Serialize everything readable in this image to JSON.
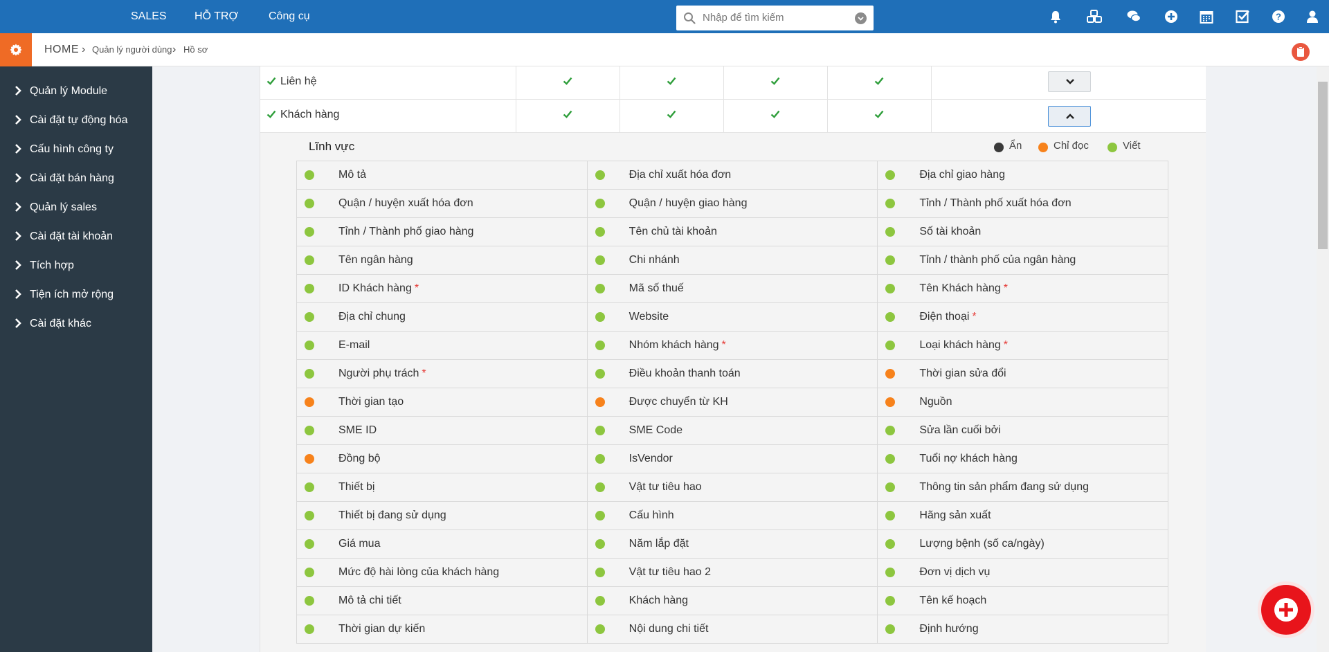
{
  "topnav": {
    "sales": "SALES",
    "support": "HỖ TRỢ",
    "tools": "Công cụ"
  },
  "search": {
    "placeholder": "Nhập để tìm kiếm"
  },
  "topicons": [
    "bell-icon",
    "cubes-icon",
    "chat-icon",
    "plus-circle-icon",
    "calendar-icon",
    "checkbox-icon",
    "help-icon",
    "user-icon"
  ],
  "breadcrumb": {
    "home": "HOME",
    "level1": "Quản lý người dùng",
    "level2": "Hồ sơ"
  },
  "sidebar": {
    "items": [
      {
        "label": "Quản lý Module"
      },
      {
        "label": "Cài đặt tự động hóa"
      },
      {
        "label": "Cấu hình công ty"
      },
      {
        "label": "Cài đặt bán hàng"
      },
      {
        "label": "Quản lý sales"
      },
      {
        "label": "Cài đặt tài khoản"
      },
      {
        "label": "Tích hợp"
      },
      {
        "label": "Tiện ích mở rộng"
      },
      {
        "label": "Cài đặt khác"
      }
    ]
  },
  "modules": [
    {
      "name": "Liên hệ",
      "expanded": false
    },
    {
      "name": "Khách hàng",
      "expanded": true
    }
  ],
  "fields_section": {
    "title": "Lĩnh vực",
    "legend": {
      "hidden": "Ẩn",
      "readonly": "Chỉ đọc",
      "write": "Viết"
    },
    "colors": {
      "hidden": "#3a3a3a",
      "readonly": "#f7821b",
      "write": "#8dc63f"
    },
    "rows": [
      [
        {
          "label": "Mô tả",
          "state": "write"
        },
        {
          "label": "Địa chỉ xuất hóa đơn",
          "state": "write"
        },
        {
          "label": "Địa chỉ giao hàng",
          "state": "write"
        }
      ],
      [
        {
          "label": "Quận / huyện xuất hóa đơn",
          "state": "write"
        },
        {
          "label": "Quận / huyện giao hàng",
          "state": "write"
        },
        {
          "label": "Tỉnh / Thành phố xuất hóa đơn",
          "state": "write"
        }
      ],
      [
        {
          "label": "Tỉnh / Thành phố giao hàng",
          "state": "write"
        },
        {
          "label": "Tên chủ tài khoản",
          "state": "write"
        },
        {
          "label": "Số tài khoản",
          "state": "write"
        }
      ],
      [
        {
          "label": "Tên ngân hàng",
          "state": "write"
        },
        {
          "label": "Chi nhánh",
          "state": "write"
        },
        {
          "label": "Tỉnh / thành phố của ngân hàng",
          "state": "write"
        }
      ],
      [
        {
          "label": "ID Khách hàng",
          "state": "write",
          "required": true
        },
        {
          "label": "Mã số thuế",
          "state": "write"
        },
        {
          "label": "Tên Khách hàng",
          "state": "write",
          "required": true
        }
      ],
      [
        {
          "label": "Địa chỉ chung",
          "state": "write"
        },
        {
          "label": "Website",
          "state": "write"
        },
        {
          "label": "Điện thoại",
          "state": "write",
          "required": true
        }
      ],
      [
        {
          "label": "E-mail",
          "state": "write"
        },
        {
          "label": "Nhóm khách hàng",
          "state": "write",
          "required": true
        },
        {
          "label": "Loại khách hàng",
          "state": "write",
          "required": true
        }
      ],
      [
        {
          "label": "Người phụ trách",
          "state": "write",
          "required": true
        },
        {
          "label": "Điều khoản thanh toán",
          "state": "write"
        },
        {
          "label": "Thời gian sửa đổi",
          "state": "readonly"
        }
      ],
      [
        {
          "label": "Thời gian tạo",
          "state": "readonly"
        },
        {
          "label": "Được chuyển từ KH",
          "state": "readonly"
        },
        {
          "label": "Nguồn",
          "state": "readonly"
        }
      ],
      [
        {
          "label": "SME ID",
          "state": "write"
        },
        {
          "label": "SME Code",
          "state": "write"
        },
        {
          "label": "Sửa lần cuối bởi",
          "state": "write"
        }
      ],
      [
        {
          "label": "Đồng bộ",
          "state": "readonly"
        },
        {
          "label": "IsVendor",
          "state": "write"
        },
        {
          "label": "Tuổi nợ khách hàng",
          "state": "write"
        }
      ],
      [
        {
          "label": "Thiết bị",
          "state": "write"
        },
        {
          "label": "Vật tư tiêu hao",
          "state": "write"
        },
        {
          "label": "Thông tin sản phẩm đang sử dụng",
          "state": "write"
        }
      ],
      [
        {
          "label": "Thiết bị đang sử dụng",
          "state": "write"
        },
        {
          "label": "Cấu hình",
          "state": "write"
        },
        {
          "label": "Hãng sản xuất",
          "state": "write"
        }
      ],
      [
        {
          "label": "Giá mua",
          "state": "write"
        },
        {
          "label": "Năm lắp đặt",
          "state": "write"
        },
        {
          "label": "Lượng bệnh (số ca/ngày)",
          "state": "write"
        }
      ],
      [
        {
          "label": "Mức độ hài lòng của khách hàng",
          "state": "write"
        },
        {
          "label": "Vật tư tiêu hao 2",
          "state": "write"
        },
        {
          "label": "Đơn vị dịch vụ",
          "state": "write"
        }
      ],
      [
        {
          "label": "Mô tả chi tiết",
          "state": "write"
        },
        {
          "label": "Khách hàng",
          "state": "write"
        },
        {
          "label": "Tên kế hoạch",
          "state": "write"
        }
      ],
      [
        {
          "label": "Thời gian dự kiến",
          "state": "write"
        },
        {
          "label": "Nội dung chi tiết",
          "state": "write"
        },
        {
          "label": "Định hướng",
          "state": "write"
        }
      ]
    ]
  }
}
